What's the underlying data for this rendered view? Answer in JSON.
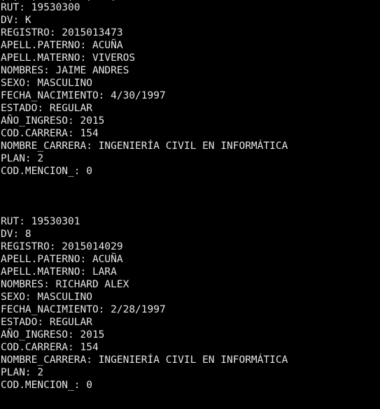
{
  "terminal": {
    "background": "#000000",
    "foreground": "#e6e6e6",
    "clipped_top_line": ", ,  ,     ,  ,   ,",
    "records": [
      {
        "lines": [
          "RUT: 19530300",
          "DV: K",
          "REGISTRO: 2015013473",
          "APELL.PATERNO: ACUÑA",
          "APELL.MATERNO: VIVEROS",
          "NOMBRES: JAIME ANDRES",
          "SEXO: MASCULINO",
          "FECHA_NACIMIENTO: 4/30/1997",
          "ESTADO: REGULAR",
          "AÑO_INGRESO: 2015",
          "COD.CARRERA: 154",
          "NOMBRE_CARRERA: INGENIERÍA CIVIL EN INFORMÁTICA",
          "PLAN: 2",
          "COD.MENCION_: 0"
        ]
      },
      {
        "lines": [
          "RUT: 19530301",
          "DV: 8",
          "REGISTRO: 2015014029",
          "APELL.PATERNO: ACUÑA",
          "APELL.MATERNO: LARA",
          "NOMBRES: RICHARD ALEX",
          "SEXO: MASCULINO",
          "FECHA_NACIMIENTO: 2/28/1997",
          "ESTADO: REGULAR",
          "AÑO_INGRESO: 2015",
          "COD.CARRERA: 154",
          "NOMBRE_CARRERA: INGENIERÍA CIVIL EN INFORMÁTICA",
          "PLAN: 2",
          "COD.MENCION_: 0"
        ]
      }
    ]
  }
}
